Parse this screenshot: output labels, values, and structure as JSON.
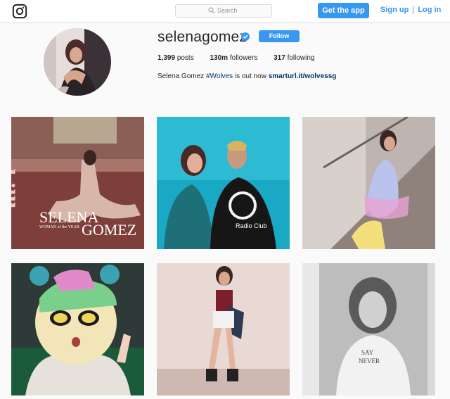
{
  "header": {
    "logo_icon": "instagram-camera-icon",
    "search_placeholder": "Search",
    "get_app_label": "Get the app",
    "signup_label": "Sign up",
    "separator": "|",
    "login_label": "Log in"
  },
  "profile": {
    "username": "selenagomez",
    "verified_icon": "verified-badge-icon",
    "follow_label": "Follow",
    "stats": {
      "posts_count": "1,399",
      "posts_label": "posts",
      "followers_count": "130m",
      "followers_label": "followers",
      "following_count": "317",
      "following_label": "following"
    },
    "bio": {
      "name": "Selena Gomez",
      "hashtag": "#Wolves",
      "text": "is out now",
      "link": "smarturl.it/wolvessg"
    }
  },
  "posts": {
    "post1": {
      "masthead": "billboard",
      "cover_name_1": "SELENA",
      "cover_name_2": "GOMEZ",
      "cover_small": "WOMAN of the YEAR"
    },
    "post2": {
      "shirt_text": "Radio Club"
    },
    "post6": {
      "shirt_text_1": "SAY",
      "shirt_text_2": "NEVER"
    }
  },
  "colors": {
    "accent": "#3897f0",
    "link": "#003569",
    "background": "#fafafa",
    "border": "#dbdbdb"
  }
}
